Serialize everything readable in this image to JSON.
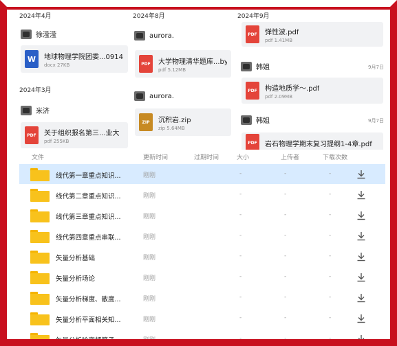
{
  "feed": {
    "col1": {
      "date1": "2024年4月",
      "sender1": "徐滢滢",
      "file1": {
        "name": "地球物理学院团委...0914",
        "size": "docx 27KB",
        "type": "W"
      },
      "date2": "2024年3月",
      "sender2": "米济",
      "file2": {
        "name": "关于组织报名第三...业大",
        "size": "pdf 255KB",
        "type": "PDF"
      }
    },
    "col2": {
      "date1": "2024年8月",
      "sender1": "aurora.",
      "file1": {
        "name": "大学物理清华题库...by",
        "size": "pdf 5.12MB",
        "type": "PDF"
      },
      "sender2": "aurora.",
      "file2": {
        "name": "沉积岩.zip",
        "size": "zip 5.64MB",
        "type": "ZIP"
      }
    },
    "col3": {
      "date1": "2024年9月",
      "file1": {
        "name": "弹性波.pdf",
        "size": "pdf 1.41MB",
        "type": "PDF"
      },
      "sender1": "韩姐",
      "time1": "9月7日",
      "file2": {
        "name": "构造地质学～.pdf",
        "size": "pdf 2.09MB",
        "type": "PDF"
      },
      "sender2": "韩姐",
      "time2": "9月7日",
      "file3": {
        "name": "岩石物理学期末复习提纲1-4章.pdf",
        "type": "PDF"
      }
    }
  },
  "table": {
    "headers": {
      "file": "文件",
      "updated": "更新时间",
      "expires": "过期时间",
      "size": "大小",
      "uploader": "上传者",
      "downloads": "下载次数"
    },
    "rows": [
      {
        "name": "线代第一章重点知识...",
        "time": "刚刚",
        "size": "-",
        "uploader": "-",
        "count": "-"
      },
      {
        "name": "线代第二章重点知识...",
        "time": "刚刚",
        "size": "-",
        "uploader": "-",
        "count": "-"
      },
      {
        "name": "线代第三章重点知识...",
        "time": "刚刚",
        "size": "-",
        "uploader": "-",
        "count": "-"
      },
      {
        "name": "线代第四章重点串联...",
        "time": "刚刚",
        "size": "-",
        "uploader": "-",
        "count": "-"
      },
      {
        "name": "矢量分析基础",
        "time": "刚刚",
        "size": "-",
        "uploader": "-",
        "count": "-"
      },
      {
        "name": "矢量分析场论",
        "time": "刚刚",
        "size": "-",
        "uploader": "-",
        "count": "-"
      },
      {
        "name": "矢量分析梯度、散度...",
        "time": "刚刚",
        "size": "-",
        "uploader": "-",
        "count": "-"
      },
      {
        "name": "矢量分析平面相关知...",
        "time": "刚刚",
        "size": "-",
        "uploader": "-",
        "count": "-"
      },
      {
        "name": "矢量分析哈密顿算子",
        "time": "刚刚",
        "size": "-",
        "uploader": "-",
        "count": "-"
      }
    ]
  },
  "colors": {
    "frame": "#c8101e",
    "selected_row": "#d8ebff",
    "folder": "#f8c21c",
    "pdf": "#e4443a",
    "docx": "#2a5fc6",
    "zip": "#c78a23"
  },
  "icons": {
    "folder": "folder-icon",
    "download": "download-icon",
    "pdf": "pdf-file-icon",
    "docx": "word-file-icon",
    "zip": "zip-file-icon"
  }
}
